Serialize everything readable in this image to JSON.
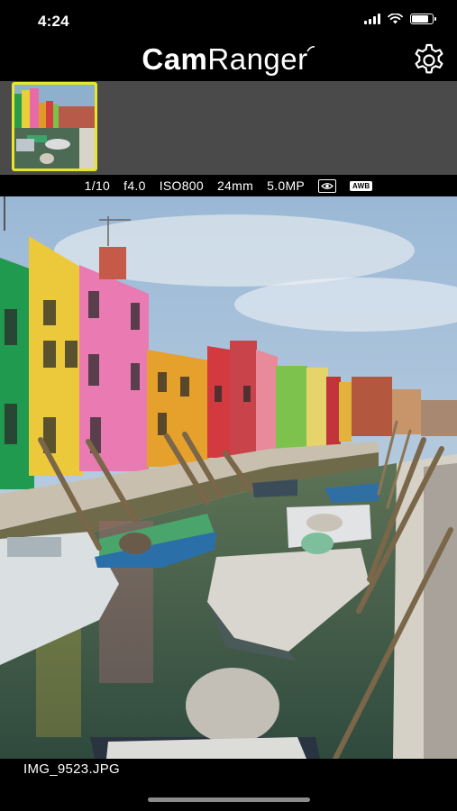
{
  "status_bar": {
    "time": "4:24",
    "battery_level": 0.9
  },
  "header": {
    "brand_bold": "Cam",
    "brand_light": "Ranger",
    "settings_icon": "gear-icon"
  },
  "thumbnails": [
    {
      "selected": true
    }
  ],
  "shot_info": {
    "shutter": "1/10",
    "aperture": "f4.0",
    "iso": "ISO800",
    "focal_length": "24mm",
    "resolution": "5.0MP",
    "metering_icon": "eye-metering-icon",
    "white_balance": "AWB"
  },
  "photo": {
    "filename": "IMG_9523.JPG"
  },
  "colors": {
    "thumbnail_highlight": "#e8e62a",
    "strip_background": "#4a4a4a"
  }
}
